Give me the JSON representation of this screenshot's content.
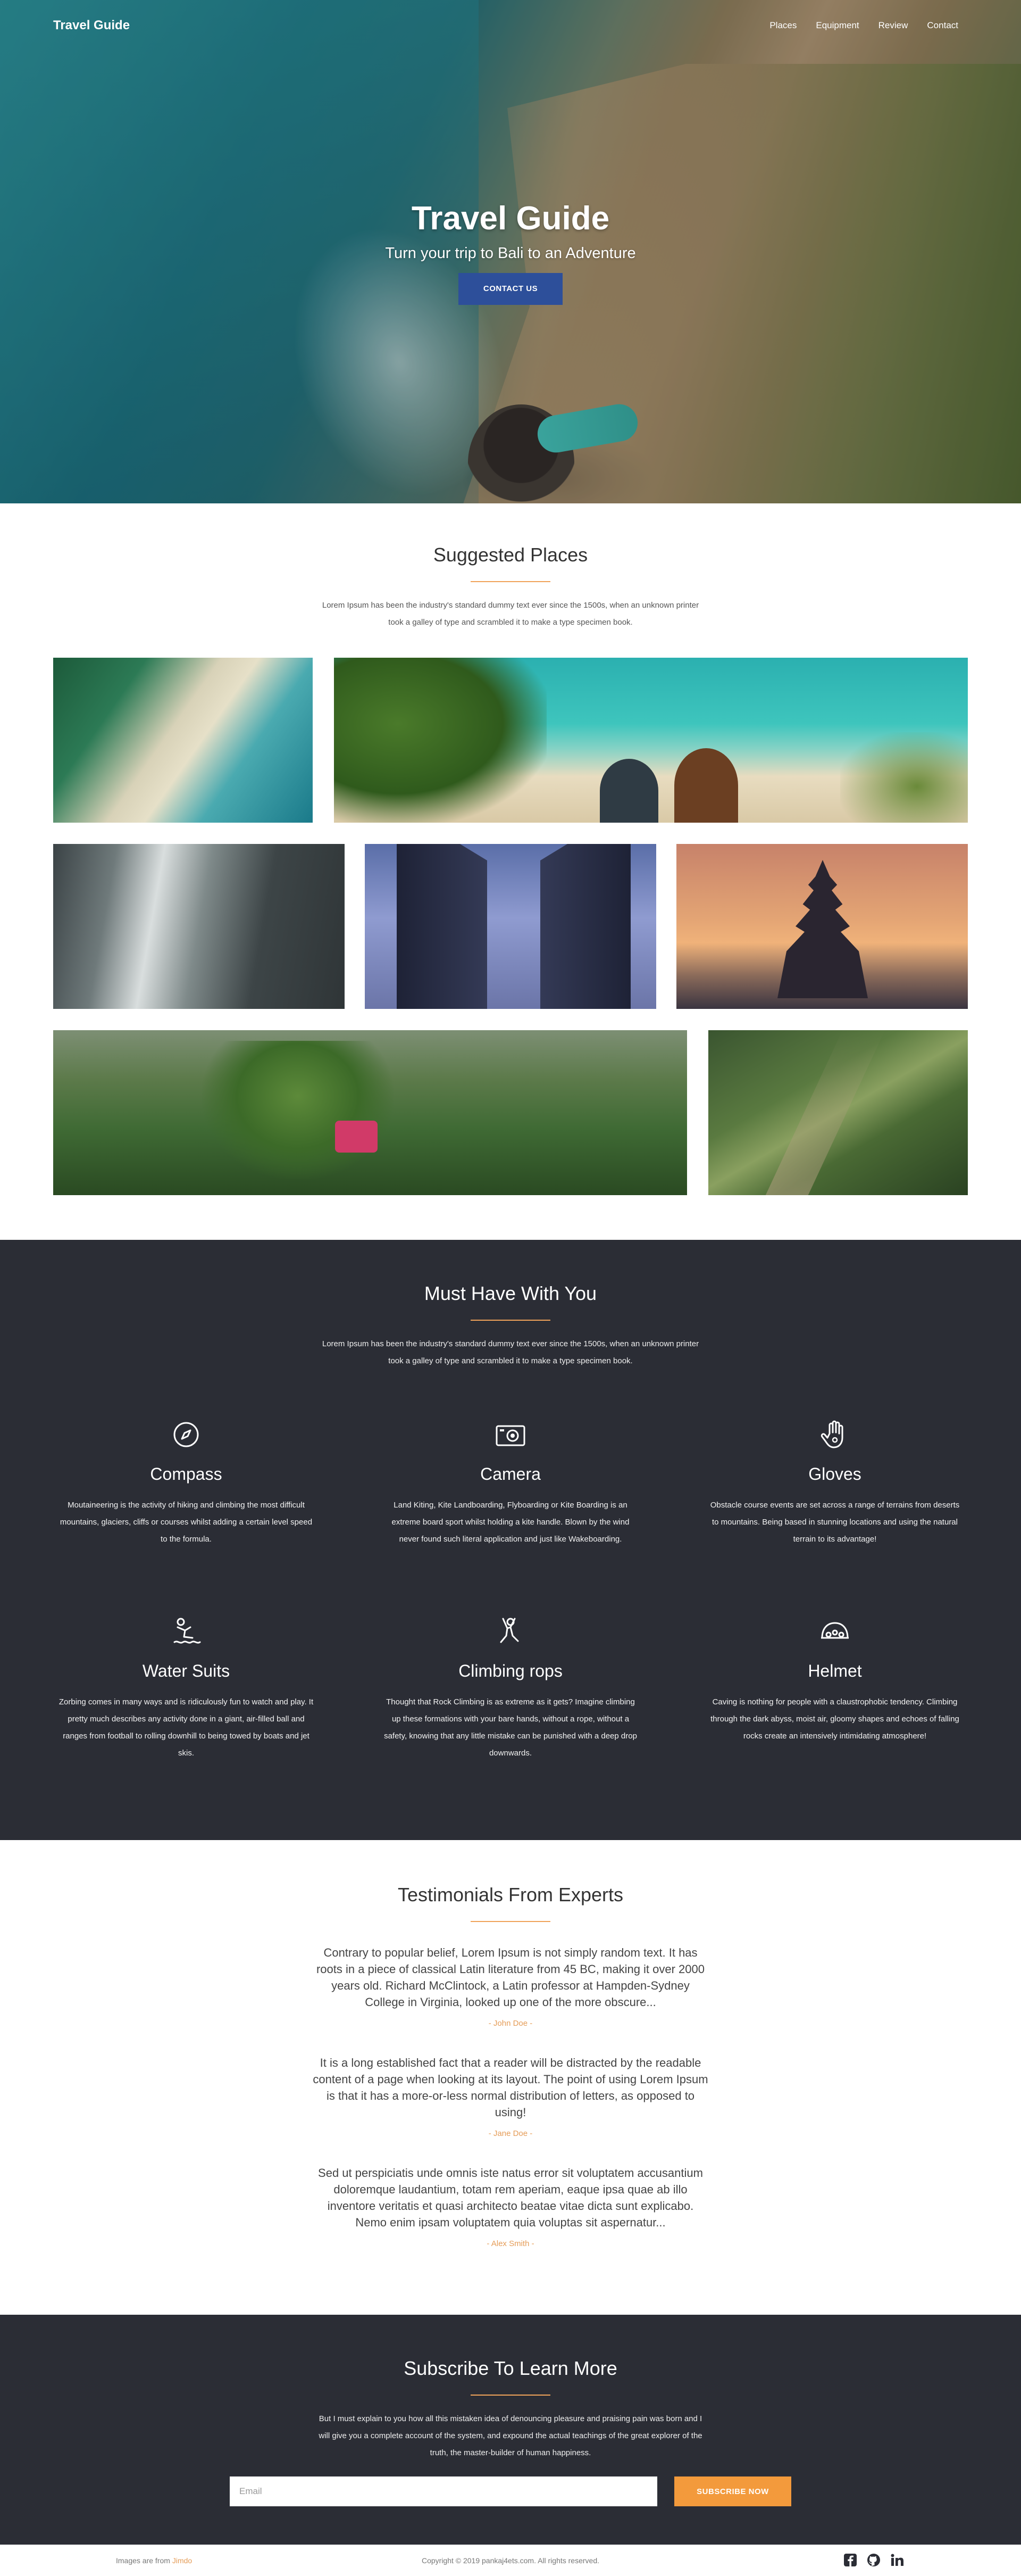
{
  "nav": {
    "brand": "Travel Guide",
    "links": [
      "Places",
      "Equipment",
      "Review",
      "Contact"
    ]
  },
  "hero": {
    "title": "Travel Guide",
    "subtitle": "Turn your trip to Bali to an Adventure",
    "button": "CONTACT US"
  },
  "places": {
    "title": "Suggested Places",
    "description": "Lorem Ipsum has been the industry's standard dummy text ever since the 1500s, when an unknown printer took a galley of type and scrambled it to make a type specimen book."
  },
  "musthave": {
    "title": "Must Have With You",
    "description": "Lorem Ipsum has been the industry's standard dummy text ever since the 1500s, when an unknown printer took a galley of type and scrambled it to make a type specimen book.",
    "items": [
      {
        "icon": "compass-icon",
        "title": "Compass",
        "text": "Moutaineering is the activity of hiking and climbing the most difficult mountains, glaciers, cliffs or courses whilst adding a certain level speed to the formula."
      },
      {
        "icon": "camera-icon",
        "title": "Camera",
        "text": "Land Kiting, Kite Landboarding, Flyboarding or Kite Boarding is an extreme board sport whilst holding a kite handle. Blown by the wind never found such literal application and just like Wakeboarding."
      },
      {
        "icon": "glove-icon",
        "title": "Gloves",
        "text": "Obstacle course events are set across a range of terrains from deserts to mountains. Being based in stunning locations and using the natural terrain to its advantage!"
      },
      {
        "icon": "water-suit-icon",
        "title": "Water Suits",
        "text": "Zorbing comes in many ways and is ridiculously fun to watch and play. It pretty much describes any activity done in a giant, air-filled ball and ranges from football to rolling downhill to being towed by boats and jet skis."
      },
      {
        "icon": "climbing-icon",
        "title": "Climbing rops",
        "text": "Thought that Rock Climbing is as extreme as it gets? Imagine climbing up these formations with your bare hands, without a rope, without a safety, knowing that any little mistake can be punished with a deep drop downwards."
      },
      {
        "icon": "helmet-icon",
        "title": "Helmet",
        "text": "Caving is nothing for people with a claustrophobic tendency. Climbing through the dark abyss, moist air, gloomy shapes and echoes of falling rocks create an intensively intimidating atmosphere!"
      }
    ]
  },
  "testimonials": {
    "title": "Testimonials From Experts",
    "items": [
      {
        "text": "Contrary to popular belief, Lorem Ipsum is not simply random text. It has roots in a piece of classical Latin literature from 45 BC, making it over 2000 years old. Richard McClintock, a Latin professor at Hampden-Sydney College in Virginia, looked up one of the more obscure...",
        "author": "- John Doe -"
      },
      {
        "text": "It is a long established fact that a reader will be distracted by the readable content of a page when looking at its layout. The point of using Lorem Ipsum is that it has a more-or-less normal distribution of letters, as opposed to using!",
        "author": "- Jane Doe -"
      },
      {
        "text": "Sed ut perspiciatis unde omnis iste natus error sit voluptatem accusantium doloremque laudantium, totam rem aperiam, eaque ipsa quae ab illo inventore veritatis et quasi architecto beatae vitae dicta sunt explicabo. Nemo enim ipsam voluptatem quia voluptas sit aspernatur...",
        "author": "- Alex Smith -"
      }
    ]
  },
  "subscribe": {
    "title": "Subscribe To Learn More",
    "description": "But I must explain to you how all this mistaken idea of denouncing pleasure and praising pain was born and I will give you a complete account of the system, and expound the actual teachings of the great explorer of the truth, the master-builder of human happiness.",
    "placeholder": "Email",
    "button": "SUBSCRIBE NOW"
  },
  "footer": {
    "left_prefix": "Images are from",
    "left_link": "Jimdo",
    "copyright": "Copyright © 2019 pankaj4ets.com. All rights reserved.",
    "icons": [
      "facebook-icon",
      "github-icon",
      "linkedin-icon"
    ]
  },
  "colors": {
    "accent": "#f39a3c",
    "dark_bg": "#2b2d35",
    "hero_button": "#2d4f9a"
  }
}
